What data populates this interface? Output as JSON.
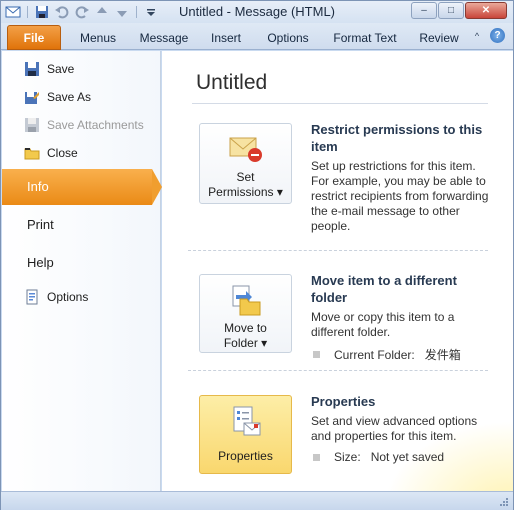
{
  "window": {
    "title": "Untitled  -  Message (HTML)",
    "qat_icons": [
      "outlook-app-icon",
      "save-icon",
      "undo-icon",
      "redo-icon",
      "up-arrow-icon",
      "down-arrow-icon",
      "customize-qat-icon"
    ],
    "buttons": {
      "minimize": "–",
      "maximize": "□",
      "close": "✕"
    }
  },
  "ribbon": {
    "tabs": [
      "File",
      "Menus",
      "Message",
      "Insert",
      "Options",
      "Format Text",
      "Review"
    ],
    "collapse_glyph": "^",
    "help_glyph": "?"
  },
  "backstage_nav": {
    "commands": [
      {
        "label": "Save",
        "icon": "save-icon",
        "enabled": true
      },
      {
        "label": "Save As",
        "icon": "save-as-icon",
        "enabled": true
      },
      {
        "label": "Save Attachments",
        "icon": "save-attachments-icon",
        "enabled": false
      },
      {
        "label": "Close",
        "icon": "close-folder-icon",
        "enabled": true
      }
    ],
    "tabs": [
      {
        "label": "Info",
        "selected": true
      },
      {
        "label": "Print",
        "selected": false
      },
      {
        "label": "Help",
        "selected": false
      }
    ],
    "options": {
      "label": "Options",
      "icon": "options-icon"
    }
  },
  "info": {
    "title": "Untitled",
    "sections": [
      {
        "button_lines": [
          "Set",
          "Permissions ▾"
        ],
        "icon": "envelope-restrict-icon",
        "heading": "Restrict permissions to this item",
        "description": "Set up restrictions for this item. For example, you may be able to restrict recipients from forwarding the e-mail message to other people."
      },
      {
        "button_lines": [
          "Move to",
          "Folder ▾"
        ],
        "icon": "move-to-folder-icon",
        "heading": "Move item to a different folder",
        "description": "Move or copy this item to a different folder.",
        "detail_label": "Current Folder:",
        "detail_value": "发件箱"
      },
      {
        "button_lines": [
          "Properties"
        ],
        "icon": "properties-icon",
        "heading": "Properties",
        "description": "Set and view advanced options and properties for this item.",
        "detail_label": "Size:",
        "detail_value": "Not yet saved"
      }
    ]
  },
  "colors": {
    "file_tab": "#e0730a",
    "selected_nav": "#f09e2f",
    "active_button": "#f9d76e"
  }
}
